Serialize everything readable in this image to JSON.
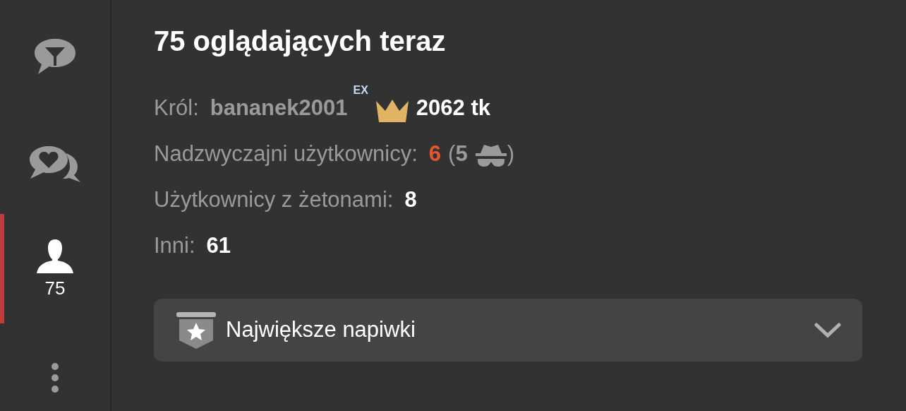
{
  "sidebar": {
    "items": [
      {
        "kind": "filter-chat",
        "selected": false
      },
      {
        "kind": "heart-chat",
        "selected": false
      },
      {
        "kind": "users",
        "label": "75",
        "selected": true
      },
      {
        "kind": "more",
        "selected": false
      }
    ]
  },
  "title": "75 oglądających teraz",
  "stats": [
    {
      "kind": "king",
      "label": "Król:",
      "user": "bananek2001",
      "badge": "EX",
      "value": "2062 tk"
    },
    {
      "kind": "special",
      "label": "Nadzwyczajni użytkownicy:",
      "value": "6",
      "open": "(",
      "hidden": "5",
      "close": ")"
    },
    {
      "kind": "plain",
      "label": "Użytkownicy z żetonami:",
      "value": "8"
    },
    {
      "kind": "plain",
      "label": "Inni:",
      "value": "61"
    }
  ],
  "dropdown": {
    "label": "Największe napiwki",
    "expanded": false
  }
}
